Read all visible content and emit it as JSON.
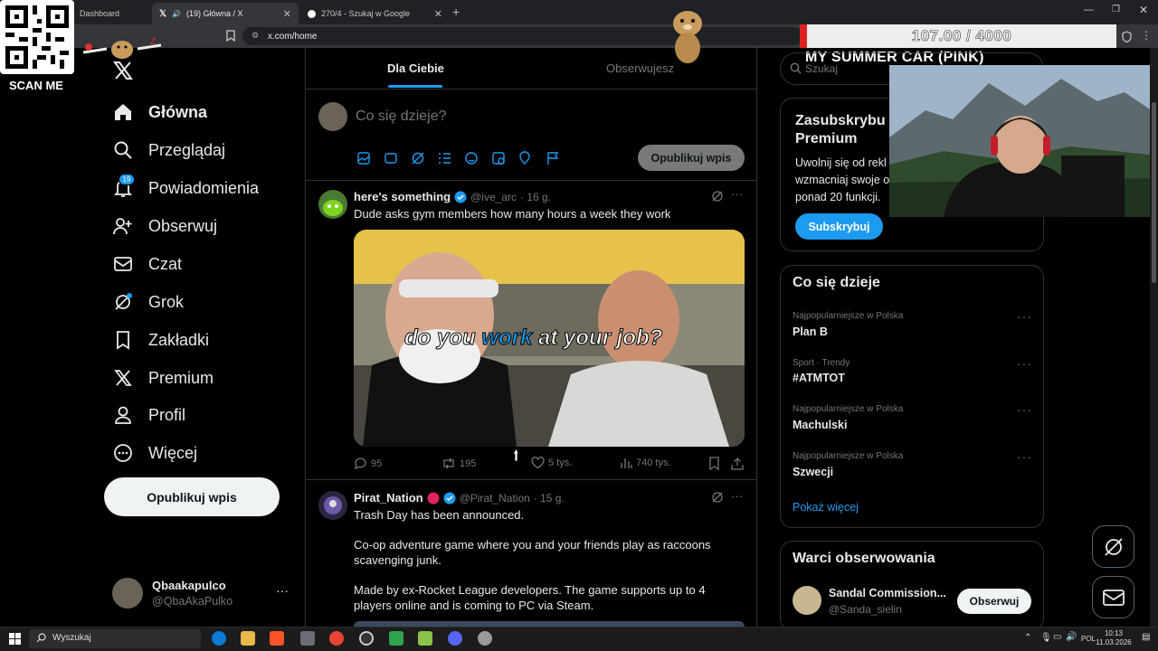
{
  "browser": {
    "tabs": [
      {
        "label": "Dashboard"
      },
      {
        "label": "(19) Główna / X"
      },
      {
        "label": "270/4 - Szukaj w Google"
      }
    ],
    "url": "x.com/home"
  },
  "overlay": {
    "qr_caption": "SCAN ME",
    "counter": "107.00 / 4000",
    "subtitle": "MY SUMMER CAR (PINK)"
  },
  "nav": {
    "items": [
      {
        "label": "Główna",
        "icon": "home-icon"
      },
      {
        "label": "Przeglądaj",
        "icon": "search-icon"
      },
      {
        "label": "Powiadomienia",
        "icon": "bell-icon"
      },
      {
        "label": "Obserwuj",
        "icon": "follow-icon"
      },
      {
        "label": "Czat",
        "icon": "mail-icon"
      },
      {
        "label": "Grok",
        "icon": "grok-icon"
      },
      {
        "label": "Zakładki",
        "icon": "bookmark-icon"
      },
      {
        "label": "Premium",
        "icon": "x-logo-icon"
      },
      {
        "label": "Profil",
        "icon": "profile-icon"
      },
      {
        "label": "Więcej",
        "icon": "more-circle-icon"
      }
    ],
    "notifications_badge": "19",
    "post_button": "Opublikuj wpis",
    "account": {
      "name": "Qbaakapulco",
      "handle": "@QbaAkaPulko"
    }
  },
  "feed": {
    "tabs": [
      "Dla Ciebie",
      "Obserwujesz"
    ],
    "composer": {
      "placeholder": "Co się dzieje?",
      "post_button": "Opublikuj wpis"
    },
    "tweets": [
      {
        "name": "here's something",
        "handle": "@ive_arc",
        "time": "· 16 g.",
        "text": "Dude asks gym members how many hours a week they work",
        "media_caption_a": "do you ",
        "media_caption_b": "work",
        "media_caption_c": " at your job?",
        "replies": "95",
        "reposts": "195",
        "likes": "5 tys.",
        "views": "740 tys."
      },
      {
        "name": "Pirat_Nation",
        "handle": "@Pirat_Nation",
        "time": "· 15 g.",
        "p1": "Trash Day has been announced.",
        "p2": "Co-op adventure game where you and your friends play as raccoons scavenging junk.",
        "p3": "Made by ex-Rocket League developers. The game supports up to 4 players online and is coming to PC via Steam."
      }
    ]
  },
  "right": {
    "search_placeholder": "Szukaj",
    "premium": {
      "title_line1": "Zasubskrybu",
      "title_line2": "Premium",
      "body_line1": "Uwolnij się od rekl",
      "body_line2": "wzmacniaj swoje o",
      "body_line3": "ponad 20 funkcji.",
      "button": "Subskrybuj"
    },
    "trends": {
      "title": "Co się dzieje",
      "items": [
        {
          "category": "Najpopularniejsze w Polska",
          "name": "Plan B"
        },
        {
          "category": "Sport · Trendy",
          "name": "#ATMTOT"
        },
        {
          "category": "Najpopularniejsze w Polska",
          "name": "Machulski"
        },
        {
          "category": "Najpopularniejsze w Polska",
          "name": "Szwecji"
        }
      ],
      "show_more": "Pokaż więcej"
    },
    "who_to_follow": {
      "title": "Warci obserwowania",
      "items": [
        {
          "name": "Sandal Commission...",
          "handle": "@Sanda_sielin",
          "button": "Obserwuj"
        }
      ]
    }
  },
  "taskbar": {
    "search": "Wyszukaj",
    "lang": "POL",
    "time": "10:13",
    "date": "11.03.2026"
  },
  "colors": {
    "accent": "#1d9bf0",
    "background": "#000000",
    "border": "#2f3336",
    "muted": "#71767b"
  }
}
